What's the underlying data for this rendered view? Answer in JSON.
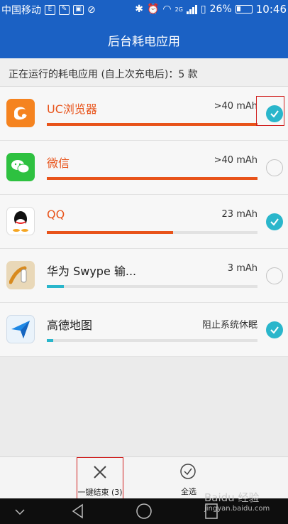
{
  "status_bar": {
    "carrier": "中国移动",
    "battery_percent": "26%",
    "time": "10:46",
    "network": "2G"
  },
  "header": {
    "title": "后台耗电应用"
  },
  "summary": {
    "text": "正在运行的耗电应用 (自上次充电后)：5 款"
  },
  "apps": [
    {
      "name": "UC浏览器",
      "usage": ">40 mAh",
      "usage_fraction": 1.0,
      "bar_color": "#e8531a",
      "checked": true,
      "icon": "uc-browser-icon",
      "name_active": true
    },
    {
      "name": "微信",
      "usage": ">40 mAh",
      "usage_fraction": 1.0,
      "bar_color": "#e8531a",
      "checked": false,
      "icon": "wechat-icon",
      "name_active": true
    },
    {
      "name": "QQ",
      "usage": "23 mAh",
      "usage_fraction": 0.6,
      "bar_color": "#e8531a",
      "checked": true,
      "icon": "qq-icon",
      "name_active": true
    },
    {
      "name": "华为 Swype 输...",
      "usage": "3 mAh",
      "usage_fraction": 0.08,
      "bar_color": "#2ab6cb",
      "checked": false,
      "icon": "swype-icon",
      "name_active": false
    },
    {
      "name": "高德地图",
      "usage": "阻止系统休眠",
      "usage_fraction": 0.03,
      "bar_color": "#2ab6cb",
      "checked": true,
      "icon": "amap-icon",
      "name_active": false
    }
  ],
  "actions": {
    "kill_all": "一键结束 (3)",
    "select_all": "全选"
  },
  "watermark": {
    "line1": "Baidu 经验",
    "line2": "jingyan.baidu.com"
  },
  "colors": {
    "accent": "#1b61c4",
    "warning": "#e8531a",
    "check": "#2ab6cb"
  }
}
